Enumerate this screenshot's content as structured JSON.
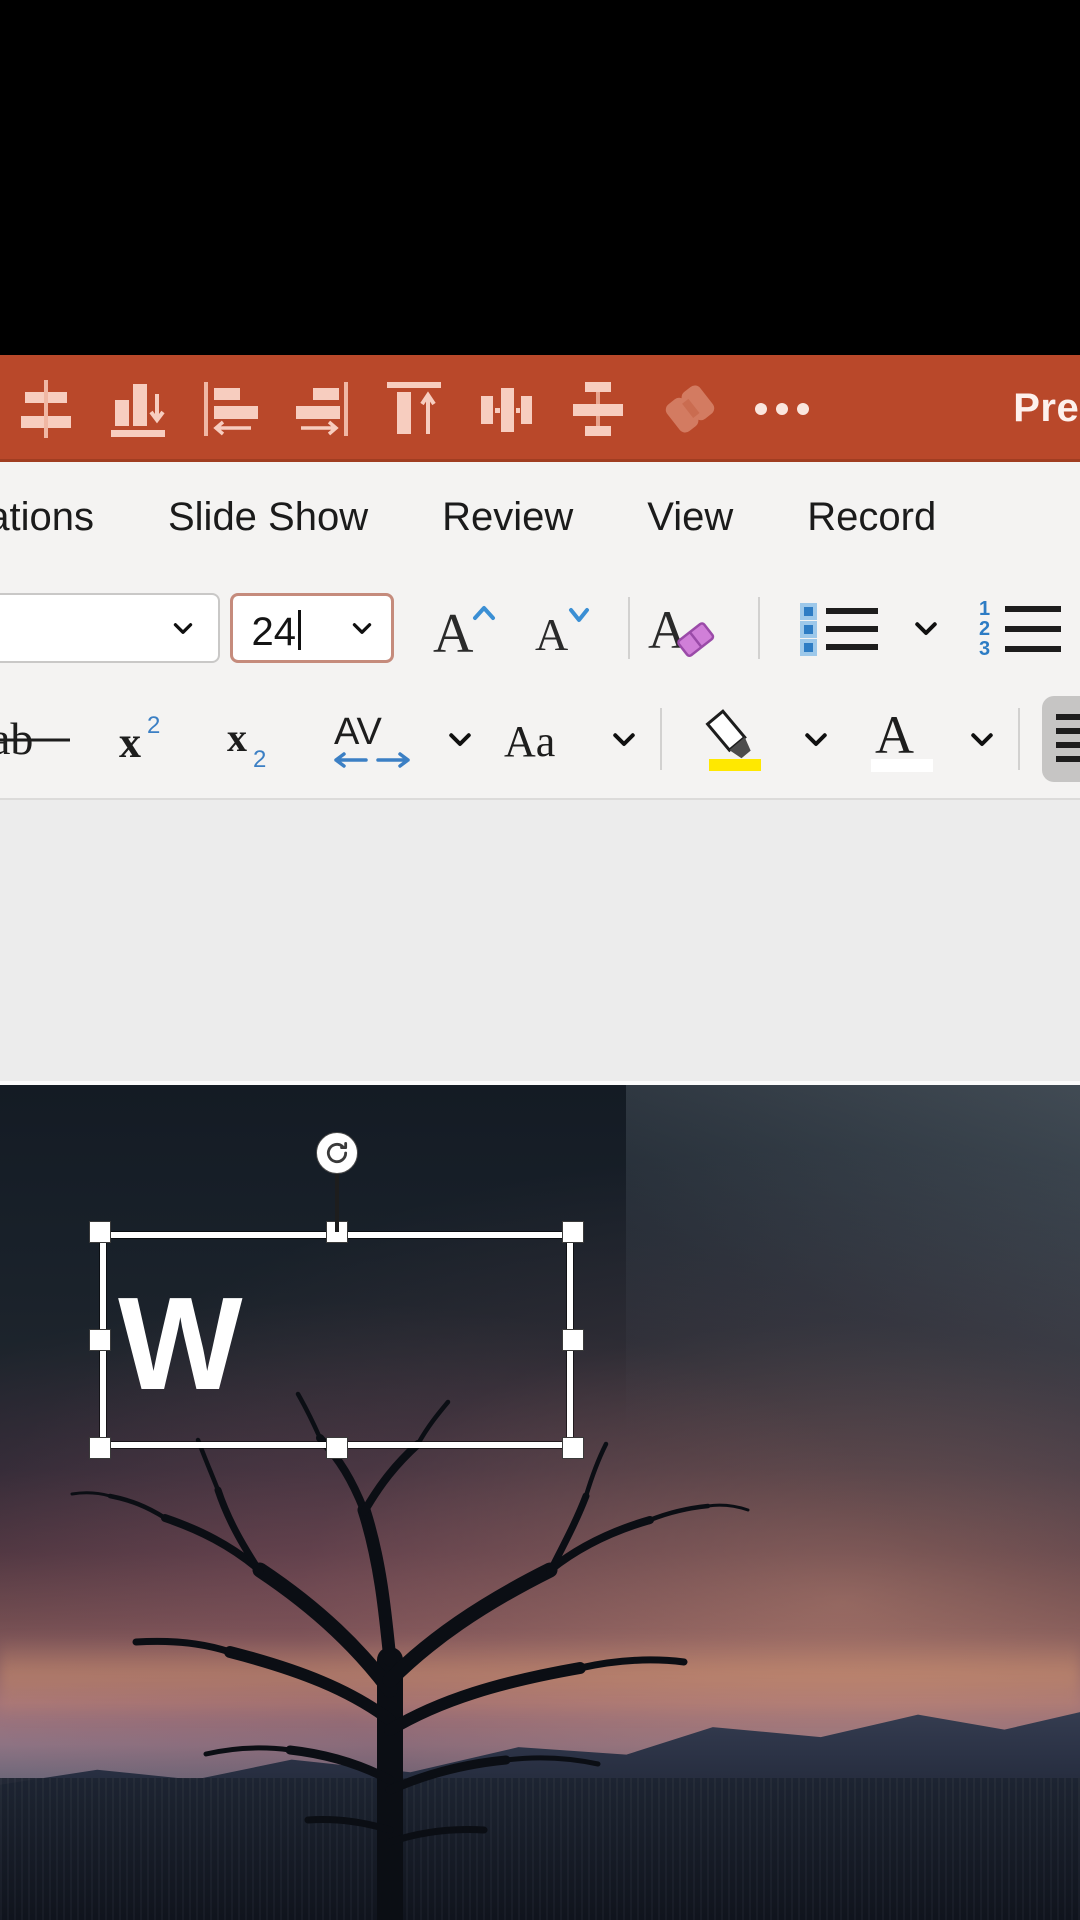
{
  "orange_toolbar": {
    "title": "Pres",
    "icons": [
      {
        "name": "align-distribute-vertical-icon",
        "label": "Distribute Vertically"
      },
      {
        "name": "align-bottom-icon",
        "label": "Align Bottom"
      },
      {
        "name": "align-left-icon",
        "label": "Align Left"
      },
      {
        "name": "align-right-icon",
        "label": "Align Right"
      },
      {
        "name": "align-top-icon",
        "label": "Align Top"
      },
      {
        "name": "align-center-horizontal-icon",
        "label": "Align Center"
      },
      {
        "name": "align-middle-icon",
        "label": "Align Middle"
      },
      {
        "name": "group-objects-icon",
        "label": "Group"
      },
      {
        "name": "more-options-icon",
        "label": "More Options"
      }
    ]
  },
  "ribbon_tabs": [
    {
      "label": "nations",
      "full": "Animations",
      "selected": false
    },
    {
      "label": "Slide Show",
      "selected": false
    },
    {
      "label": "Review",
      "selected": false
    },
    {
      "label": "View",
      "selected": false
    },
    {
      "label": "Record",
      "selected": false
    }
  ],
  "font_group": {
    "font_name_value": "",
    "font_name_placeholder": "",
    "font_size_value": "24",
    "font_size_focused": true,
    "grow_font_label": "A",
    "shrink_font_label": "A",
    "clear_formatting_label": "A"
  },
  "format_row": {
    "strikethrough_label": "ab",
    "superscript_label": "x",
    "superscript_sup": "2",
    "subscript_label": "x",
    "subscript_sub": "2",
    "char_spacing_label": "AV",
    "change_case_label": "Aa",
    "highlight_color": "#ffe800",
    "font_color": "#ffffff"
  },
  "paragraph_group": {
    "numbered_items": [
      "1",
      "2",
      "3"
    ],
    "align_left_selected": true
  },
  "slide": {
    "textbox_text": "W",
    "rotate_handle_icon": "rotate-icon",
    "selected": true
  },
  "colors": {
    "ribbon_accent": "#b9482a",
    "ribbon_bg": "#f4f3f2",
    "focus_border": "#c58b7c",
    "canvas_bg": "#ececec"
  }
}
